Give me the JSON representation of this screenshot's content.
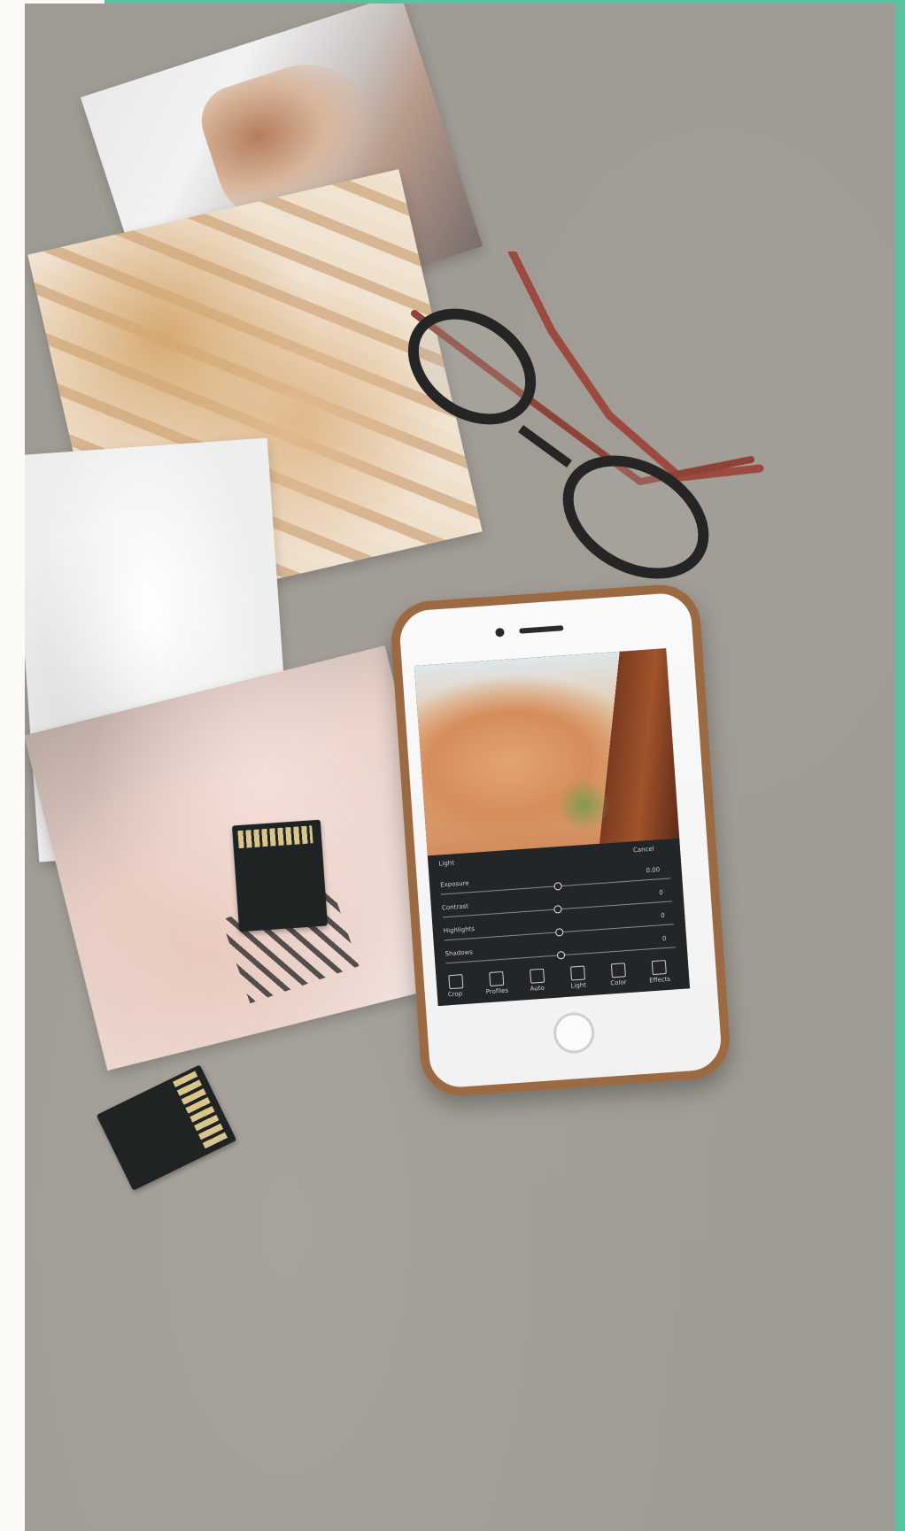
{
  "scene": {
    "background_color": "#9e9a94",
    "accent_color": "#59c3a0",
    "objects": [
      "printed-photo",
      "eyeglasses",
      "sd-card",
      "smartphone"
    ]
  },
  "phone": {
    "frame_color": "#9b6a43",
    "screen": {
      "top_label": "Cancel",
      "section_label": "Light",
      "sliders": [
        {
          "label": "Exposure",
          "value": "0.00"
        },
        {
          "label": "Contrast",
          "value": "0"
        },
        {
          "label": "Highlights",
          "value": "0"
        },
        {
          "label": "Shadows",
          "value": "0"
        }
      ],
      "toolbar": [
        {
          "label": "Crop",
          "icon": "crop-icon"
        },
        {
          "label": "Profiles",
          "icon": "profiles-icon"
        },
        {
          "label": "Auto",
          "icon": "auto-icon"
        },
        {
          "label": "Light",
          "icon": "light-icon"
        },
        {
          "label": "Color",
          "icon": "color-icon"
        },
        {
          "label": "Effects",
          "icon": "effects-icon"
        }
      ]
    }
  }
}
